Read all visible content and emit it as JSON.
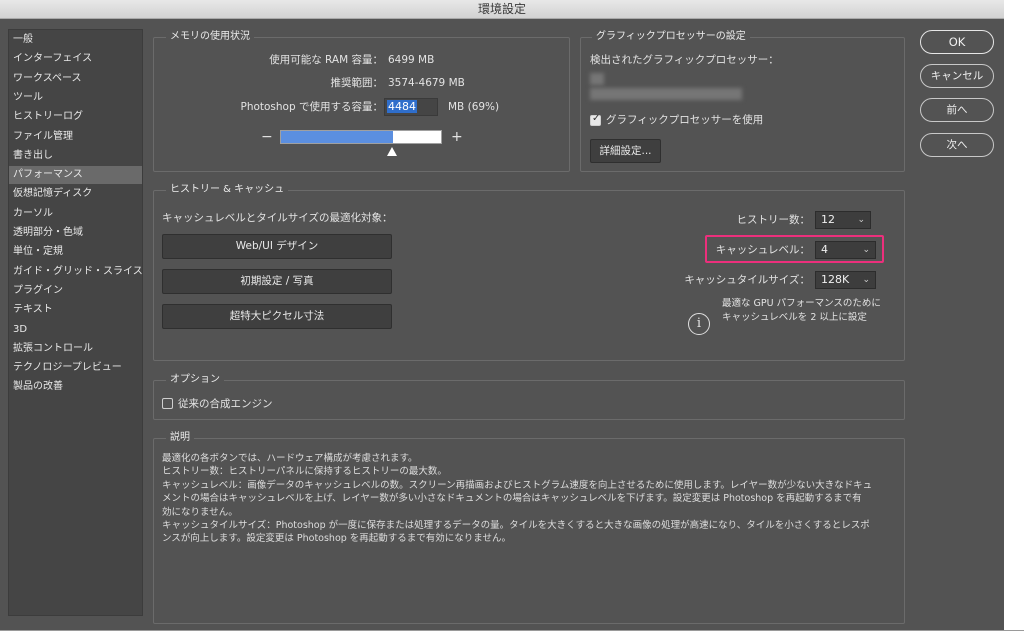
{
  "window": {
    "title": "環境設定"
  },
  "sidebar": {
    "items": [
      {
        "label": "一般"
      },
      {
        "label": "インターフェイス"
      },
      {
        "label": "ワークスペース"
      },
      {
        "label": "ツール"
      },
      {
        "label": "ヒストリーログ"
      },
      {
        "label": "ファイル管理"
      },
      {
        "label": "書き出し"
      },
      {
        "label": "パフォーマンス",
        "selected": true
      },
      {
        "label": "仮想記憶ディスク"
      },
      {
        "label": "カーソル"
      },
      {
        "label": "透明部分・色域"
      },
      {
        "label": "単位・定規"
      },
      {
        "label": "ガイド・グリッド・スライス"
      },
      {
        "label": "プラグイン"
      },
      {
        "label": "テキスト"
      },
      {
        "label": "3D"
      },
      {
        "label": "拡張コントロール"
      },
      {
        "label": "テクノロジープレビュー"
      },
      {
        "label": "製品の改善"
      }
    ]
  },
  "memory": {
    "title": "メモリの使用状況",
    "available_label": "使用可能な RAM 容量：",
    "available_value": "6499 MB",
    "recommended_label": "推奨範囲：",
    "recommended_value": "3574-4679 MB",
    "use_label": "Photoshop で使用する容量：",
    "use_value": "4484",
    "use_unit": "MB (69%)",
    "use_percent": 69,
    "minus": "−",
    "plus": "+"
  },
  "gpu": {
    "title": "グラフィックプロセッサーの設定",
    "detected_label": "検出されたグラフィックプロセッサー：",
    "use_gpu_label": "グラフィックプロセッサーを使用",
    "use_gpu_checked": true,
    "advanced_button": "詳細設定..."
  },
  "history_cache": {
    "title": "ヒストリー & キャッシュ",
    "optimize_label": "キャッシュレベルとタイルサイズの最適化対象：",
    "buttons": [
      "Web/UI デザイン",
      "初期設定 / 写真",
      "超特大ピクセル寸法"
    ],
    "history_label": "ヒストリー数：",
    "history_value": "12",
    "cache_level_label": "キャッシュレベル：",
    "cache_level_value": "4",
    "tile_label": "キャッシュタイルサイズ：",
    "tile_value": "128K",
    "info_line1": "最適な GPU パフォーマンスのために",
    "info_line2": "キャッシュレベルを 2 以上に設定",
    "info_icon_glyph": "i"
  },
  "options": {
    "title": "オプション",
    "legacy_engine_label": "従来の合成エンジン",
    "legacy_engine_checked": false
  },
  "description": {
    "title": "説明",
    "lines": [
      "最適化の各ボタンでは、ハードウェア構成が考慮されます。",
      "ヒストリー数：ヒストリーパネルに保持するヒストリーの最大数。",
      "キャッシュレベル：画像データのキャッシュレベルの数。スクリーン再描画およびヒストグラム速度を向上させるために使用します。レイヤー数が少ない大きなドキュ",
      "メントの場合はキャッシュレベルを上げ、レイヤー数が多い小さなドキュメントの場合はキャッシュレベルを下げます。設定変更は Photoshop を再起動するまで有",
      "効になりません。",
      "キャッシュタイルサイズ：Photoshop が一度に保存または処理するデータの量。タイルを大きくすると大きな画像の処理が高速になり、タイルを小さくするとレスポ",
      "ンスが向上します。設定変更は Photoshop を再起動するまで有効になりません。"
    ]
  },
  "dialog_buttons": {
    "ok": "OK",
    "cancel": "キャンセル",
    "prev": "前へ",
    "next": "次へ"
  },
  "colors": {
    "background": "#535353",
    "highlight": "#ec2f7c",
    "accent": "#5b8fe0"
  }
}
